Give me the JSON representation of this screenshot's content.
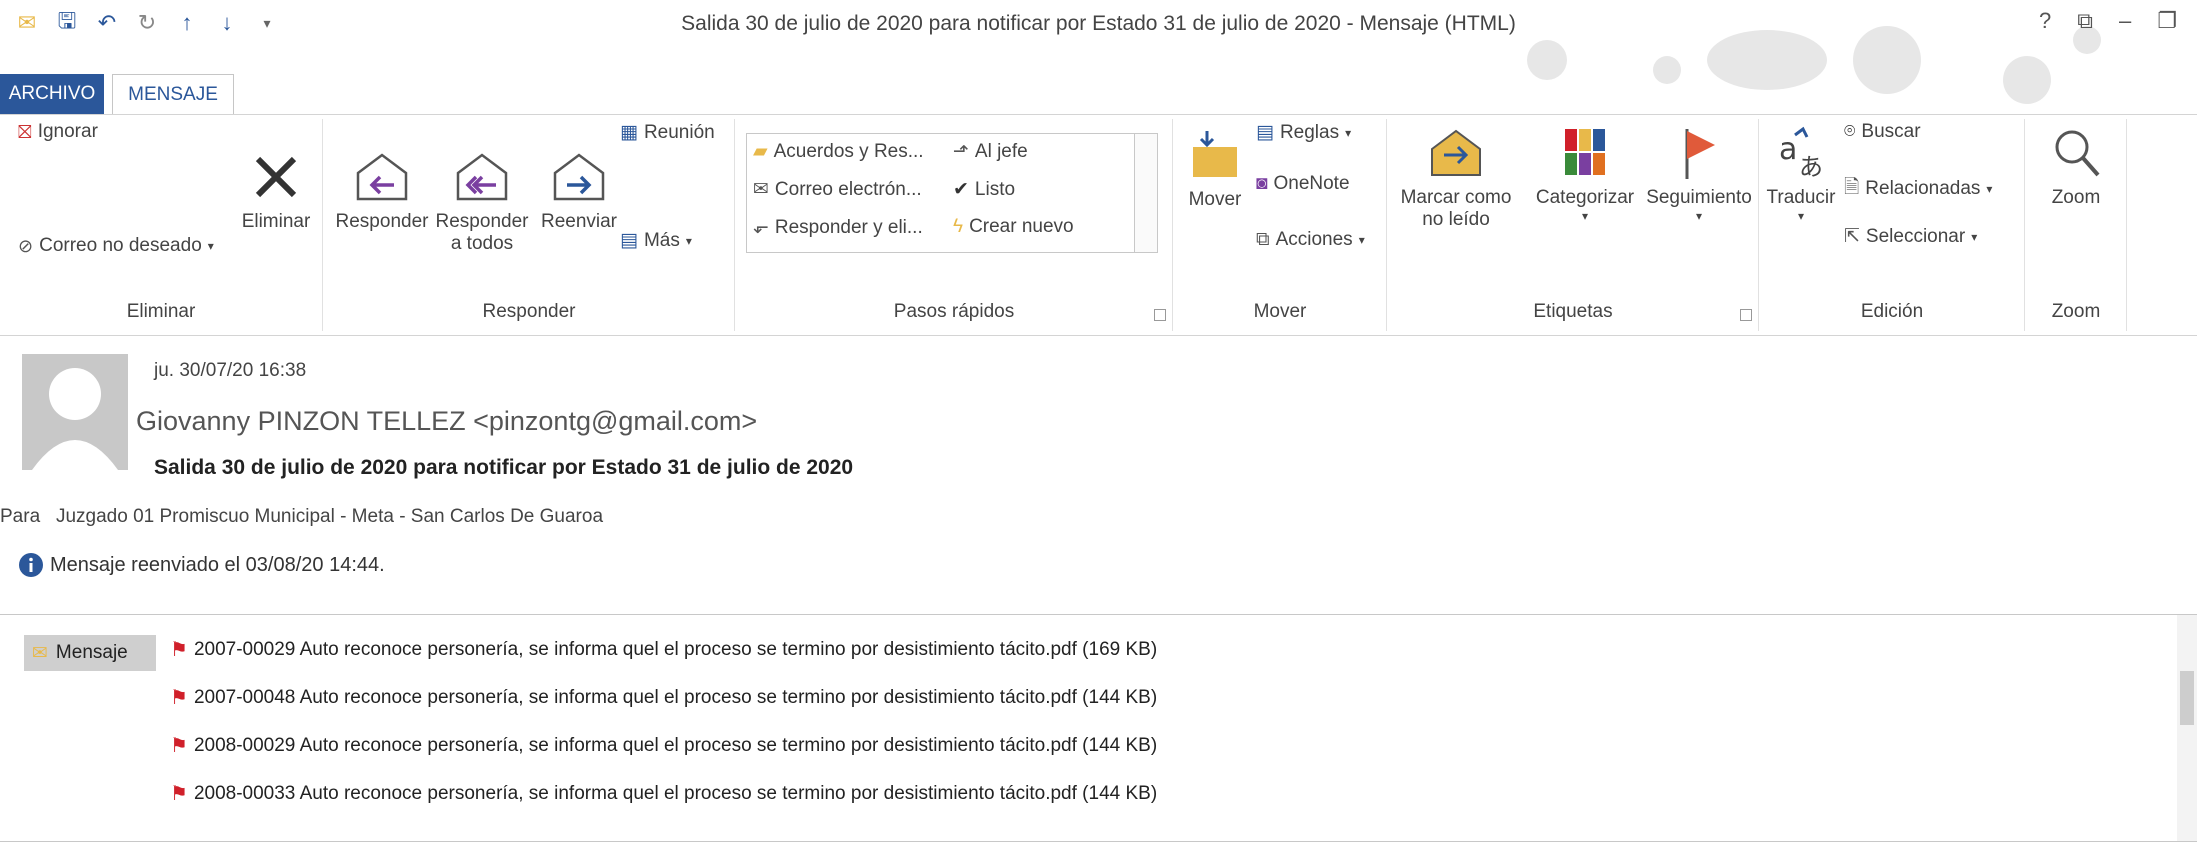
{
  "window": {
    "title": "Salida 30 de julio de 2020 para notificar por Estado 31 de julio de 2020 - Mensaje (HTML)",
    "controls": [
      "?",
      "⧉",
      "–",
      "❐"
    ]
  },
  "tabs": {
    "file": "ARCHIVO",
    "message": "MENSAJE"
  },
  "ribbon": {
    "eliminar": {
      "label": "Eliminar",
      "ignorar": "Ignorar",
      "junk": "Correo no deseado",
      "delete": "Eliminar"
    },
    "responder": {
      "label": "Responder",
      "reply": "Responder",
      "reply_all": "Responder a todos",
      "forward": "Reenviar",
      "meeting": "Reunión",
      "more": "Más"
    },
    "pasos": {
      "label": "Pasos rápidos",
      "items": [
        "Acuerdos y Res...",
        "Al jefe",
        "Correo electrón...",
        "Listo",
        "Responder y eli...",
        "Crear nuevo"
      ]
    },
    "mover": {
      "label": "Mover",
      "move": "Mover",
      "rules": "Reglas",
      "onenote": "OneNote",
      "actions": "Acciones"
    },
    "etiquetas": {
      "label": "Etiquetas",
      "unread": "Marcar como no leído",
      "categorize": "Categorizar",
      "followup": "Seguimiento"
    },
    "edicion": {
      "label": "Edición",
      "translate": "Traducir",
      "find": "Buscar",
      "related": "Relacionadas",
      "select": "Seleccionar"
    },
    "zoom": {
      "label": "Zoom",
      "zoom": "Zoom"
    }
  },
  "message": {
    "date": "ju. 30/07/20 16:38",
    "from": "Giovanny PINZON TELLEZ <pinzontg@gmail.com>",
    "subject": "Salida 30 de julio de 2020 para notificar por Estado 31 de julio de 2020",
    "to_label": "Para",
    "to": "Juzgado 01 Promiscuo Municipal - Meta - San Carlos De Guaroa",
    "info": "Mensaje reenviado el 03/08/20 14:44."
  },
  "attachments": {
    "message_chip": "Mensaje",
    "files": [
      "2007-00029  Auto reconoce personería, se informa quel el proceso se termino por desistimiento tácito.pdf (169 KB)",
      "2007-00048  Auto reconoce personería, se informa quel el proceso se termino por desistimiento tácito.pdf (144 KB)",
      "2008-00029  Auto reconoce personería, se informa quel el proceso se termino por desistimiento tácito.pdf (144 KB)",
      "2008-00033 Auto reconoce personería, se informa quel el proceso se termino por desistimiento tácito.pdf (144 KB)"
    ]
  },
  "colors": {
    "accent": "#2b579a",
    "pdf": "#d0202a",
    "yellow": "#e8b94a"
  }
}
